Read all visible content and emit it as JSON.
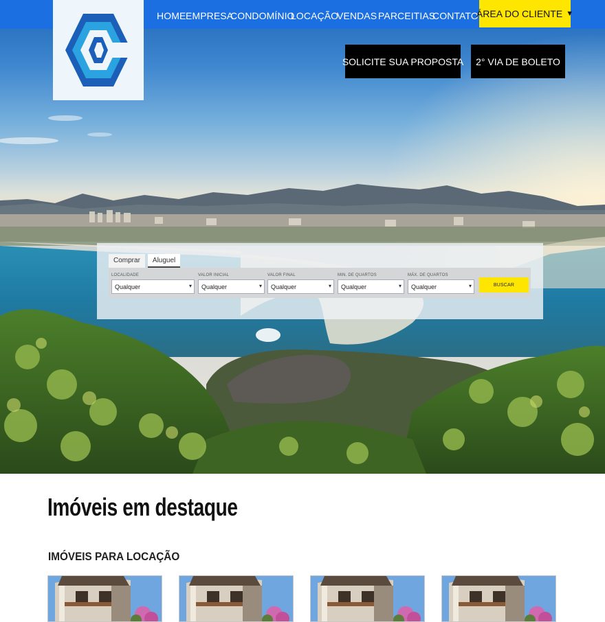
{
  "nav": {
    "items": [
      "HOME",
      "EMPRESA",
      "CONDOMÍNIO",
      "LOCAÇÃO",
      "VENDAS",
      "PARCEITIAS",
      "CONTATO"
    ],
    "client_area": "ÁREA DO CLIENTE",
    "client_area_icon": "caret-down-icon"
  },
  "cta": {
    "proposal": "SOLICITE SUA PROPOSTA",
    "boleto": "2° VIA DE BOLETO"
  },
  "search": {
    "tabs": [
      "Comprar",
      "Aluguel"
    ],
    "active_tab": "Aluguel",
    "fields": [
      {
        "label": "LOCALIDADE",
        "value": "Qualquer"
      },
      {
        "label": "VALOR INICIAL",
        "value": "Qualquer"
      },
      {
        "label": "VALOR FINAL",
        "value": "Qualquer"
      },
      {
        "label": "MIN. DE QUARTOS",
        "value": "Qualquer"
      },
      {
        "label": "MÁX. DE QUARTOS",
        "value": "Qualquer"
      }
    ],
    "submit": "BUSCAR"
  },
  "main": {
    "title": "Imóveis em destaque",
    "subtitle": "IMÓVEIS PARA LOCAÇÃO"
  },
  "colors": {
    "nav_blue": "#1b6fe0",
    "accent_yellow": "#ffe600",
    "cta_black": "#000000",
    "logo_blue_dark": "#1b5fb8",
    "logo_blue_light": "#2aa3e0"
  }
}
